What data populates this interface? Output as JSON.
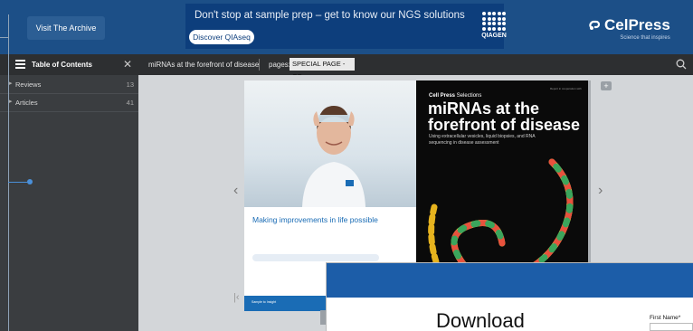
{
  "topbar": {
    "archive_button": "Visit The Archive",
    "ad": {
      "headline": "Don't stop at sample prep – get to know our NGS solutions",
      "button": "Discover QIAseq",
      "logo_text": "QIAGEN"
    },
    "brand": {
      "name": "CelPress",
      "tagline": "Science that inspires"
    }
  },
  "toolbar": {
    "toc_title": "Table of Contents",
    "doc_title": "miRNAs at the forefront of disease",
    "pages_label": "pages:",
    "pages_value": "SPECIAL PAGE - OF"
  },
  "sidebar": {
    "items": [
      {
        "label": "Reviews",
        "count": "13"
      },
      {
        "label": "Articles",
        "count": "41"
      }
    ]
  },
  "spread": {
    "left_page": {
      "card_title": "Making improvements in life possible",
      "logo_text": "QIAGEN",
      "card_cta": "Sample to Insight"
    },
    "right_page": {
      "series": "Cell Press",
      "series_suffix": " Selections",
      "title": "miRNAs at the forefront of disease",
      "subtitle": "Using extracellular vesicles, liquid biopsies, and RNA sequencing in disease assessment",
      "corner": "Report in cooperation with"
    }
  },
  "popup": {
    "title": "Download",
    "first_name_label": "First Name*"
  },
  "colors": {
    "brand_blue": "#1c4f87",
    "ad_blue": "#0d3e7c",
    "toolbar": "#2d2f31",
    "sidebar": "#3a3d40",
    "popup_header": "#1c5da8"
  }
}
